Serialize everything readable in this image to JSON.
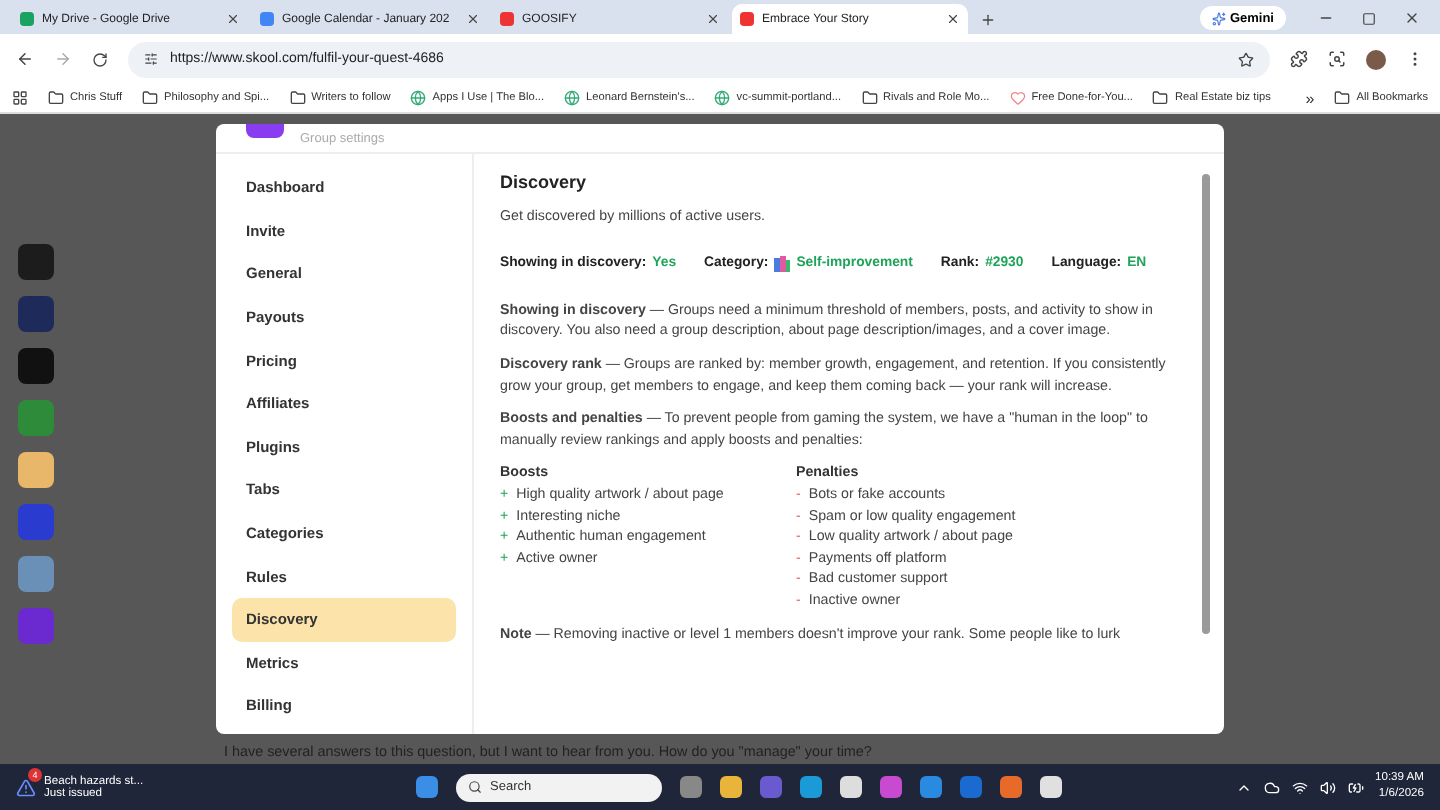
{
  "browser": {
    "tabs": [
      {
        "title": "My Drive - Google Drive",
        "selected": false
      },
      {
        "title": "Google Calendar - January 202",
        "selected": false
      },
      {
        "title": "GOOSIFY",
        "selected": false
      },
      {
        "title": "Embrace Your Story",
        "selected": true
      }
    ],
    "gemini": "Gemini",
    "url": "https://www.skool.com/fulfil-your-quest-4686",
    "bookmarks": [
      "Chris Stuff",
      "Philosophy and Spi...",
      "Writers to follow",
      "Apps I Use | The Blo...",
      "Leonard Bernstein's...",
      "vc-summit-portland...",
      "Rivals and Role Mo...",
      "Free Done-for-You...",
      "Real Estate biz tips"
    ],
    "more": "»",
    "all_bookmarks": "All Bookmarks"
  },
  "page": {
    "rail_tiles": [
      {
        "color": "#1c1c1c"
      },
      {
        "color": "#1e2a5a"
      },
      {
        "color": "#111111"
      },
      {
        "color": "#2e8b3a"
      },
      {
        "color": "#e8b76a"
      },
      {
        "color": "#2a3bd0"
      },
      {
        "color": "#6a90b8"
      },
      {
        "color": "#6a2ad0"
      }
    ],
    "background_text": "I have several answers to this question, but I want to hear from you. How do you \"manage\" your time?"
  },
  "modal": {
    "header": "Group settings",
    "nav": [
      {
        "label": "Dashboard",
        "selected": false
      },
      {
        "label": "Invite",
        "selected": false
      },
      {
        "label": "General",
        "selected": false
      },
      {
        "label": "Payouts",
        "selected": false
      },
      {
        "label": "Pricing",
        "selected": false
      },
      {
        "label": "Affiliates",
        "selected": false
      },
      {
        "label": "Plugins",
        "selected": false
      },
      {
        "label": "Tabs",
        "selected": false
      },
      {
        "label": "Categories",
        "selected": false
      },
      {
        "label": "Rules",
        "selected": false
      },
      {
        "label": "Discovery",
        "selected": true
      },
      {
        "label": "Metrics",
        "selected": false
      },
      {
        "label": "Billing",
        "selected": false
      }
    ],
    "title": "Discovery",
    "subtitle": "Get discovered by millions of active users.",
    "stats": [
      {
        "label": "Showing in discovery:",
        "value": "Yes"
      },
      {
        "label": "Category:",
        "value": "Self-improvement",
        "kind": "category"
      },
      {
        "label": "Rank:",
        "value": "#2930"
      },
      {
        "label": "Language:",
        "value": "EN"
      }
    ],
    "paragraphs": [
      "**Showing in discovery** — Groups need a minimum threshold of members, posts, and activity to show in discovery. You also need a group description, about page description/images, and a cover image.",
      "**Discovery rank** — Groups are ranked by: member growth, engagement, and retention. If you consistently grow your group, get members to engage, and keep them coming back — your rank will increase.",
      "**Boosts and penalties** — To prevent people from gaming the system, we have a \"human in the loop\" to manually review rankings and apply boosts and penalties:"
    ],
    "lists": [
      {
        "heading": "Boosts",
        "kind": "boost",
        "marker": "+",
        "items": [
          "High quality artwork / about page",
          "Interesting niche",
          "Authentic human engagement",
          "Active owner"
        ]
      },
      {
        "heading": "Penalties",
        "kind": "penalty",
        "marker": "-",
        "items": [
          "Bots or fake accounts",
          "Spam or low quality engagement",
          "Low quality artwork / about page",
          "Payments off platform",
          "Bad customer support",
          "Inactive owner"
        ]
      }
    ],
    "note": "**Note** — Removing inactive or level 1 members doesn't improve your rank. Some people like to lurk"
  },
  "taskbar": {
    "notification_count": "4",
    "notification_title": "Beach hazards st...",
    "notification_sub": "Just issued",
    "search": "Search",
    "time": "10:39 AM",
    "date": "1/6/2026"
  }
}
